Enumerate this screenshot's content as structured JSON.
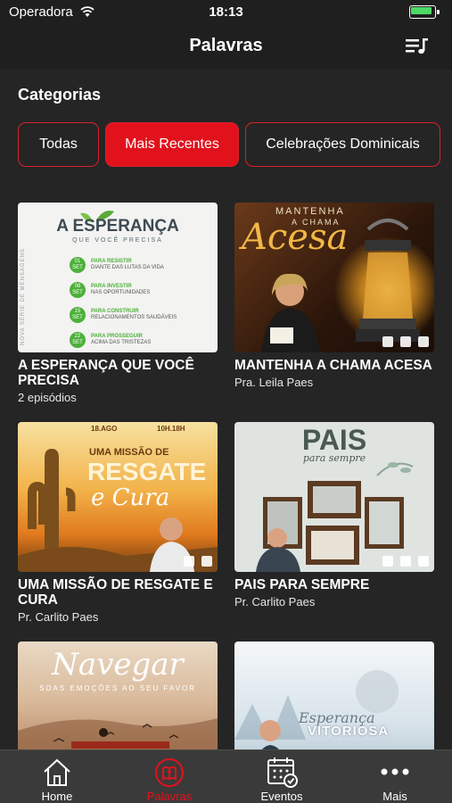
{
  "status": {
    "carrier": "Operadora",
    "time": "18:13"
  },
  "nav": {
    "title": "Palavras"
  },
  "section": {
    "title": "Categorias"
  },
  "chips": [
    {
      "label": "Todas",
      "active": false
    },
    {
      "label": "Mais Recentes",
      "active": true
    },
    {
      "label": "Celebrações Dominicais",
      "active": false
    }
  ],
  "cards": [
    {
      "title": "A ESPERANÇA QUE VOCÊ PRECISA",
      "subtitle": "2 episódios",
      "art": {
        "heading": "A ESPERANÇA",
        "tagline": "QUE VOCÊ PRECISA",
        "side_text": "NOVA SÉRIE DE MENSAGENS",
        "schedule": [
          {
            "day": "01",
            "mon": "SET",
            "verb": "PARA RESISTIR",
            "rest": "DIANTE DAS LUTAS DA VIDA"
          },
          {
            "day": "08",
            "mon": "SET",
            "verb": "PARA INVESTIR",
            "rest": "NAS OPORTUNIDADES"
          },
          {
            "day": "15",
            "mon": "SET",
            "verb": "PARA CONSTRUIR",
            "rest": "RELACIONAMENTOS SAUDÁVEIS"
          },
          {
            "day": "22",
            "mon": "SET",
            "verb": "PARA PROSSEGUIR",
            "rest": "ACIMA DAS TRISTEZAS"
          }
        ]
      }
    },
    {
      "title": "MANTENHA A CHAMA ACESA",
      "subtitle": "Pra. Leila Paes",
      "art": {
        "top": "MANTENHA",
        "mid": "A CHAMA",
        "script": "Acesa"
      }
    },
    {
      "title": "UMA MISSÃO DE RESGATE E CURA",
      "subtitle": "Pr. Carlito Paes",
      "art": {
        "date": "18.AGO",
        "time": "10H.18H",
        "line1": "UMA MISSÃO DE",
        "line2": "RESGATE",
        "script": "e Cura"
      }
    },
    {
      "title": "PAIS PARA SEMPRE",
      "subtitle": "Pr. Carlito Paes",
      "art": {
        "heading": "PAIS",
        "script": "para sempre"
      }
    },
    {
      "title": "",
      "subtitle": "",
      "art": {
        "script": "Navegar",
        "tagline": "SOAS EMOÇÕES AO SEU FAVOR"
      }
    },
    {
      "title": "",
      "subtitle": "",
      "art": {
        "script": "Esperança",
        "heading": "VITORIOSA"
      }
    }
  ],
  "tabs": [
    {
      "label": "Home",
      "active": false,
      "icon": "home-icon"
    },
    {
      "label": "Palavras",
      "active": true,
      "icon": "bible-icon"
    },
    {
      "label": "Eventos",
      "active": false,
      "icon": "calendar-icon"
    },
    {
      "label": "Mais",
      "active": false,
      "icon": "more-icon"
    }
  ],
  "colors": {
    "accent": "#e1121c",
    "background": "#252525",
    "bar": "#1f1f1f",
    "tabbar": "#3a3a3a"
  }
}
